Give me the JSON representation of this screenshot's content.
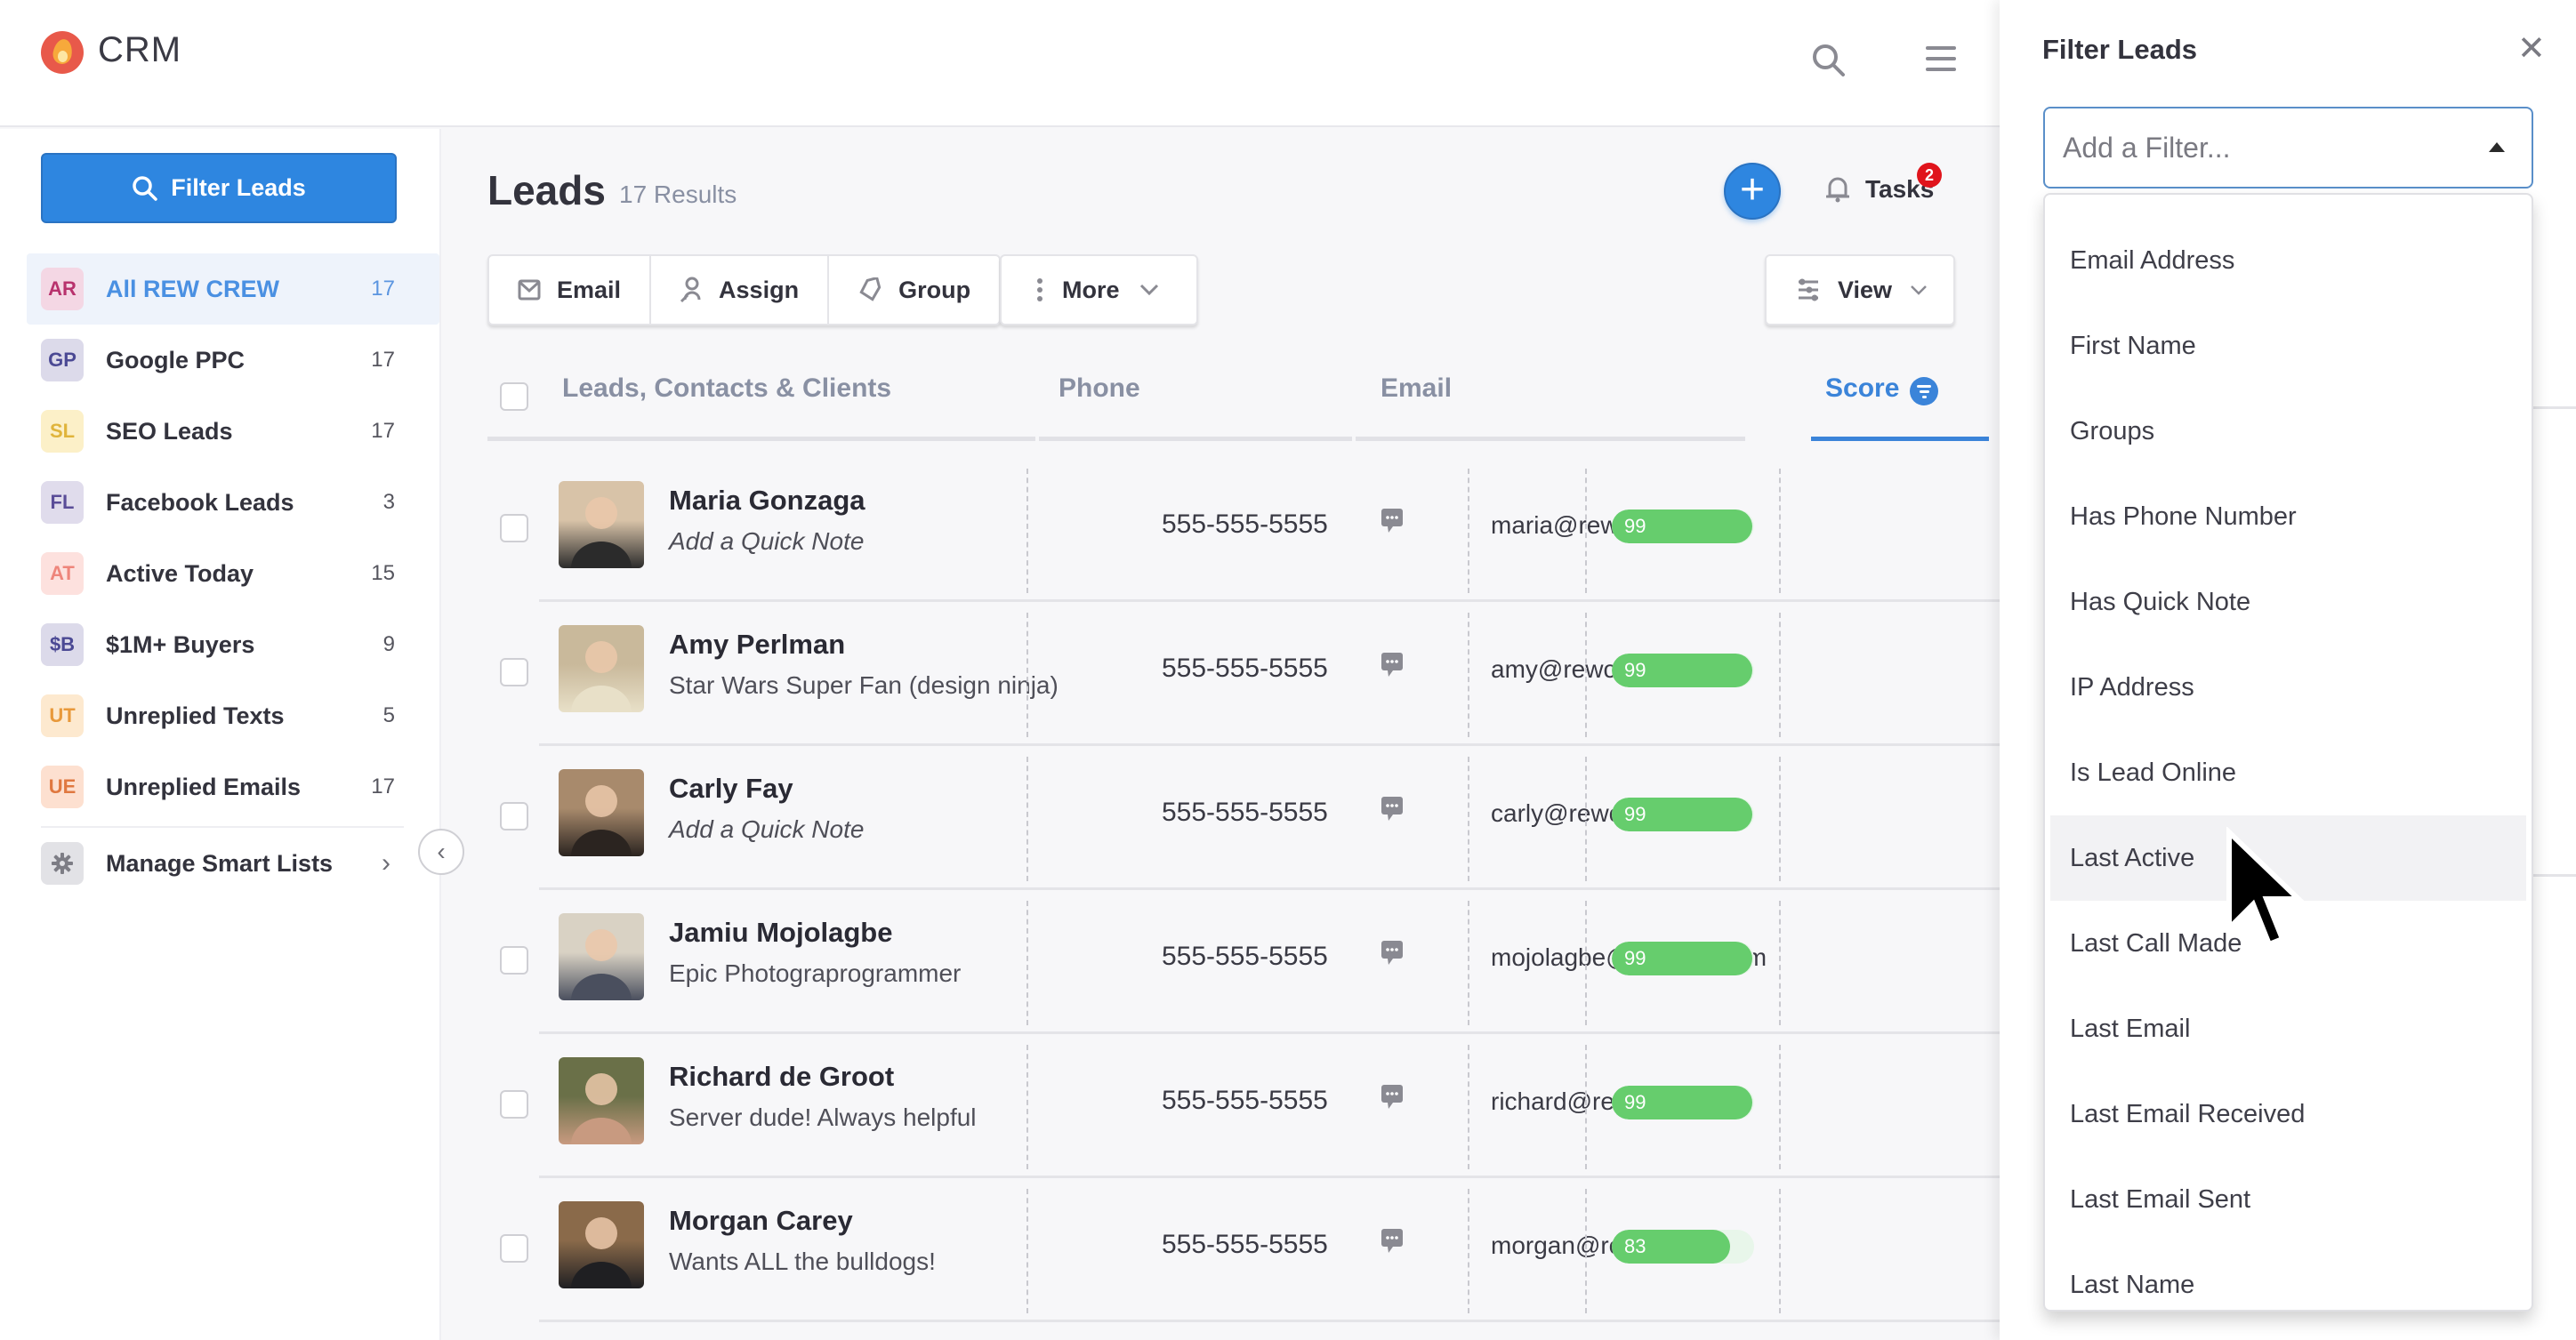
{
  "app": {
    "title": "CRM"
  },
  "topbar": {
    "search_icon": "search-icon",
    "menu_icon": "hamburger-menu-icon"
  },
  "sidebar": {
    "filter_button_label": "Filter Leads",
    "smart_lists": [
      {
        "abbr": "AR",
        "label": "All REW CREW",
        "count": "17",
        "bg": "#f4d7e4",
        "fg": "#b8326d",
        "active": true
      },
      {
        "abbr": "GP",
        "label": "Google PPC",
        "count": "17",
        "bg": "#dcdaea",
        "fg": "#4b4994",
        "active": false
      },
      {
        "abbr": "SL",
        "label": "SEO Leads",
        "count": "17",
        "bg": "#fcf0c8",
        "fg": "#e0b43b",
        "active": false
      },
      {
        "abbr": "FL",
        "label": "Facebook Leads",
        "count": "3",
        "bg": "#e0dcec",
        "fg": "#5a4d98",
        "active": false
      },
      {
        "abbr": "AT",
        "label": "Active Today",
        "count": "15",
        "bg": "#fde1de",
        "fg": "#ee857b",
        "active": false
      },
      {
        "abbr": "$B",
        "label": "$1M+ Buyers",
        "count": "9",
        "bg": "#dcdaea",
        "fg": "#4b4994",
        "active": false
      },
      {
        "abbr": "UT",
        "label": "Unreplied Texts",
        "count": "5",
        "bg": "#fde9cf",
        "fg": "#e8993b",
        "active": false
      },
      {
        "abbr": "UE",
        "label": "Unreplied Emails",
        "count": "17",
        "bg": "#fde0d0",
        "fg": "#e07840",
        "active": false
      }
    ],
    "manage_label": "Manage Smart Lists"
  },
  "main": {
    "title": "Leads",
    "results": "17 Results",
    "tasks_label": "Tasks",
    "tasks_count": "2",
    "toolbar": {
      "email": "Email",
      "assign": "Assign",
      "group": "Group",
      "more": "More",
      "view": "View"
    },
    "columns": {
      "name": "Leads, Contacts & Clients",
      "phone": "Phone",
      "email": "Email",
      "score": "Score"
    },
    "leads": [
      {
        "name": "Maria Gonzaga",
        "note": "Add a Quick Note",
        "note_placeholder": true,
        "phone": "555-555-5555",
        "email": "maria@rewcrm.com",
        "score": 99,
        "avatar_colors": [
          "#d8c3a8",
          "#2b2b2b"
        ]
      },
      {
        "name": "Amy Perlman",
        "note": "Star Wars Super Fan (design ninja)",
        "note_placeholder": false,
        "phone": "555-555-5555",
        "email": "amy@rewcrm.com",
        "score": 99,
        "avatar_colors": [
          "#c9b99b",
          "#e8e0c8"
        ]
      },
      {
        "name": "Carly Fay",
        "note": "Add a Quick Note",
        "note_placeholder": true,
        "phone": "555-555-5555",
        "email": "carly@rewcrm.com",
        "score": 99,
        "avatar_colors": [
          "#a88a6c",
          "#2b2420"
        ]
      },
      {
        "name": "Jamiu Mojolagbe",
        "note": "Epic Photograprogrammer",
        "note_placeholder": false,
        "phone": "555-555-5555",
        "email": "mojolagbe@rewcrm.com",
        "score": 99,
        "avatar_colors": [
          "#d9d2c4",
          "#4a4f5e"
        ]
      },
      {
        "name": "Richard de Groot",
        "note": "Server dude! Always helpful",
        "note_placeholder": false,
        "phone": "555-555-5555",
        "email": "richard@rewcrm.com",
        "score": 99,
        "avatar_colors": [
          "#6a7048",
          "#c89a80"
        ]
      },
      {
        "name": "Morgan Carey",
        "note": "Wants ALL the bulldogs!",
        "note_placeholder": false,
        "phone": "555-555-5555",
        "email": "morgan@rewcrm.com",
        "score": 83,
        "avatar_colors": [
          "#8a6a4a",
          "#1f1f22"
        ]
      }
    ],
    "score_color": "#66cd6d",
    "accent_color": "#2e86e0"
  },
  "filter_panel": {
    "title": "Filter Leads",
    "select_placeholder": "Add a Filter...",
    "hovered_option": "Last Active",
    "options": [
      "Email Address",
      "First Name",
      "Groups",
      "Has Phone Number",
      "Has Quick Note",
      "IP Address",
      "Is Lead Online",
      "Last Active",
      "Last Call Made",
      "Last Email",
      "Last Email Received",
      "Last Email Sent",
      "Last Name"
    ]
  }
}
